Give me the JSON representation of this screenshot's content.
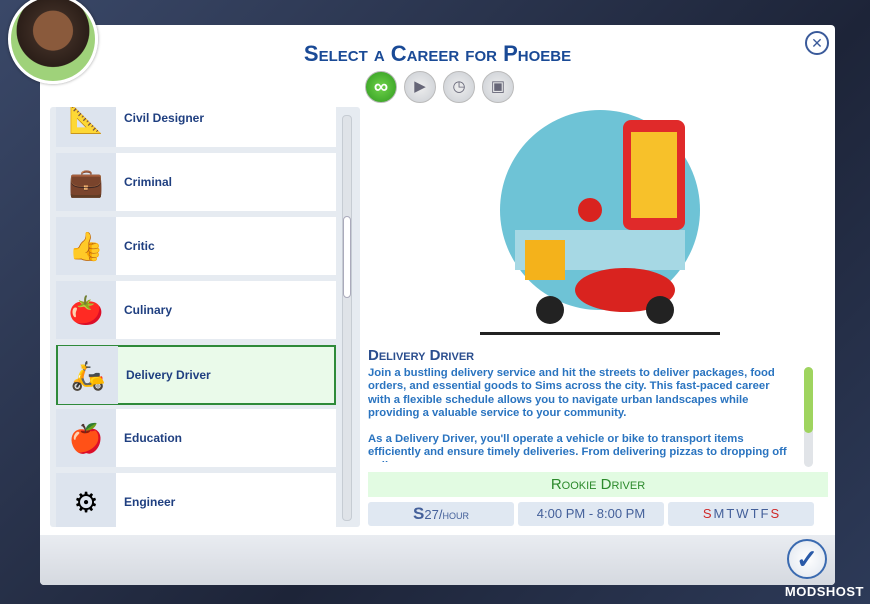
{
  "title": "Select a Career for Phoebe",
  "filters": [
    {
      "icon": "infinity-icon",
      "active": true
    },
    {
      "icon": "briefcase-play-icon"
    },
    {
      "icon": "briefcase-clock-icon"
    },
    {
      "icon": "briefcases-icon"
    }
  ],
  "careers": [
    {
      "label": "Civil Designer",
      "icon": "blueprint-icon",
      "glyph": "📐"
    },
    {
      "label": "Criminal",
      "icon": "money-case-icon",
      "glyph": "💼"
    },
    {
      "label": "Critic",
      "icon": "thumbs-icon",
      "glyph": "👍"
    },
    {
      "label": "Culinary",
      "icon": "cutting-board-icon",
      "glyph": "🍅"
    },
    {
      "label": "Delivery Driver",
      "icon": "scooter-icon",
      "glyph": "🛵",
      "selected": true
    },
    {
      "label": "Education",
      "icon": "book-apple-icon",
      "glyph": "🍎"
    },
    {
      "label": "Engineer",
      "icon": "gear-icon",
      "glyph": "⚙"
    }
  ],
  "detail": {
    "name": "Delivery Driver",
    "paragraphs": [
      "Join a bustling delivery service and hit the streets to deliver packages, food orders, and essential goods to Sims across the city. This fast-paced career with a flexible schedule allows you to navigate urban landscapes while providing a valuable service to your community.",
      "As a Delivery Driver, you'll operate a vehicle or bike to transport items efficiently and ensure timely deliveries. From delivering pizzas to dropping off online"
    ],
    "level": "Rookie Driver",
    "pay_symbol": "S",
    "pay": "27/hour",
    "hours": "4:00 PM - 8:00 PM",
    "days": [
      "S",
      "M",
      "T",
      "W",
      "T",
      "F",
      "S"
    ]
  },
  "watermark": "MODSHOST"
}
